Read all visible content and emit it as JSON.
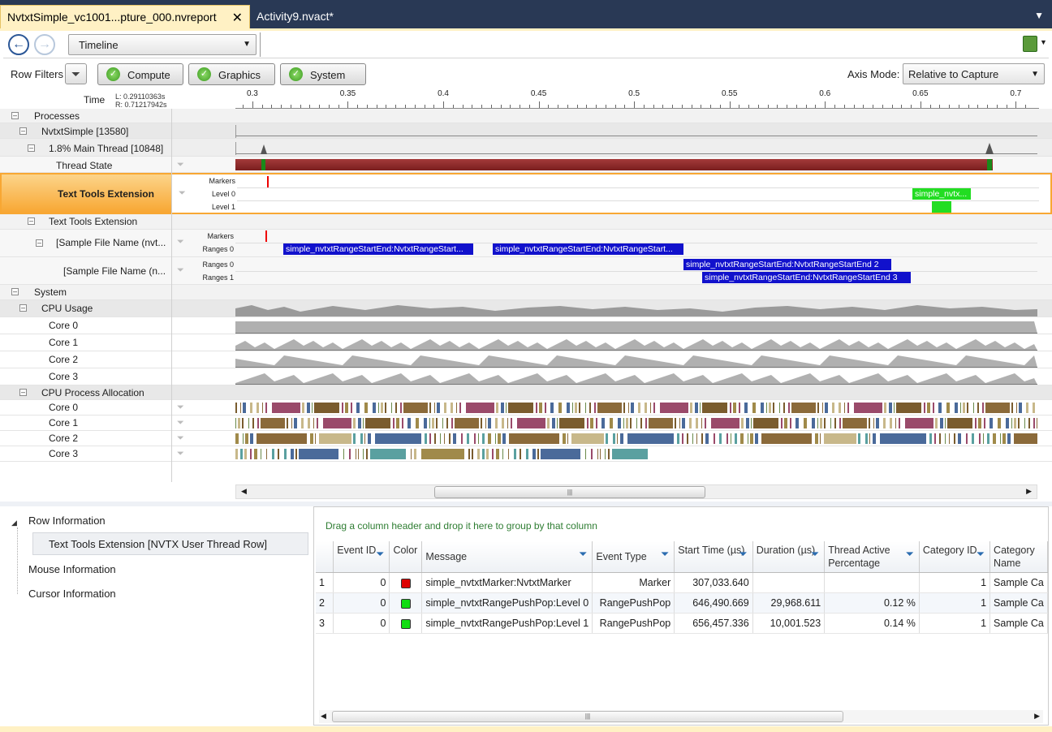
{
  "tabs": [
    {
      "label": "NvtxtSimple_vc1001...pture_000.nvreport",
      "active": true,
      "close": "✕"
    },
    {
      "label": "Activity9.nvact*",
      "active": false
    }
  ],
  "toolbar": {
    "view": "Timeline"
  },
  "filters": {
    "label": "Row Filters",
    "buttons": [
      "Compute",
      "Graphics",
      "System"
    ],
    "axis_mode_label": "Axis Mode:",
    "axis_mode_value": "Relative to Capture"
  },
  "timeline": {
    "time_label": "Time",
    "left_time": "L: 0.29110363s",
    "right_time": "R: 0.71217942s",
    "ticks": [
      "0.3",
      "0.35",
      "0.4",
      "0.45",
      "0.5",
      "0.55",
      "0.6",
      "0.65",
      "0.7"
    ]
  },
  "rows": {
    "processes": "Processes",
    "nvtxt": "NvtxtSimple [13580]",
    "main_thread": "1.8% Main Thread [10848]",
    "thread_state": "Thread State",
    "text_tools_sel": "Text Tools Extension",
    "text_tools": "Text Tools Extension",
    "sample1": "[Sample File Name (nvt...",
    "sample2": "[Sample File Name (n...",
    "system": "System",
    "cpu_usage": "CPU Usage",
    "cpu_alloc": "CPU Process Allocation",
    "core0": "Core 0",
    "core1": "Core 1",
    "core2": "Core 2",
    "core3": "Core 3"
  },
  "sublabels": {
    "markers": "Markers",
    "level0": "Level 0",
    "level1": "Level 1",
    "ranges0": "Ranges 0",
    "ranges1": "Ranges 1"
  },
  "ranges": {
    "green0": "simple_nvtx...",
    "r1": "simple_nvtxtRangeStartEnd:NvtxtRangeStart...",
    "r2": "simple_nvtxtRangeStartEnd:NvtxtRangeStart...",
    "r3": "simple_nvtxtRangeStartEnd:NvtxtRangeStartEnd 2",
    "r4": "simple_nvtxtRangeStartEnd:NvtxtRangeStartEnd 3"
  },
  "info": {
    "row_info": "Row Information",
    "row_item": "Text Tools Extension [NVTX User Thread Row]",
    "mouse_info": "Mouse Information",
    "cursor_info": "Cursor Information"
  },
  "grid": {
    "group_hint": "Drag a column header and drop it here to group by that column",
    "headers": [
      "Event ID",
      "Color",
      "Message",
      "Event Type",
      "Start Time (µs)",
      "Duration (µs)",
      "Thread Active Percentage",
      "Category ID",
      "Category Name"
    ],
    "rows": [
      {
        "n": "1",
        "event_id": "0",
        "color": "#dd0000",
        "message": "simple_nvtxtMarker:NvtxtMarker",
        "type": "Marker",
        "start": "307,033.640",
        "duration": "",
        "active": "",
        "cat_id": "1",
        "cat_name": "Sample Ca"
      },
      {
        "n": "2",
        "event_id": "0",
        "color": "#11dd11",
        "message": "simple_nvtxtRangePushPop:Level 0",
        "type": "RangePushPop",
        "start": "646,490.669",
        "duration": "29,968.611",
        "active": "0.12 %",
        "cat_id": "1",
        "cat_name": "Sample Ca"
      },
      {
        "n": "3",
        "event_id": "0",
        "color": "#11dd11",
        "message": "simple_nvtxtRangePushPop:Level 1",
        "type": "RangePushPop",
        "start": "656,457.336",
        "duration": "10,001.523",
        "active": "0.14 %",
        "cat_id": "1",
        "cat_name": "Sample Ca"
      }
    ]
  },
  "colors": {
    "accent": "#fff1c4",
    "selected_row": "#f8a733",
    "range_blue": "#1111cc",
    "range_green": "#22dd22",
    "thread_state": "#8b2323"
  }
}
